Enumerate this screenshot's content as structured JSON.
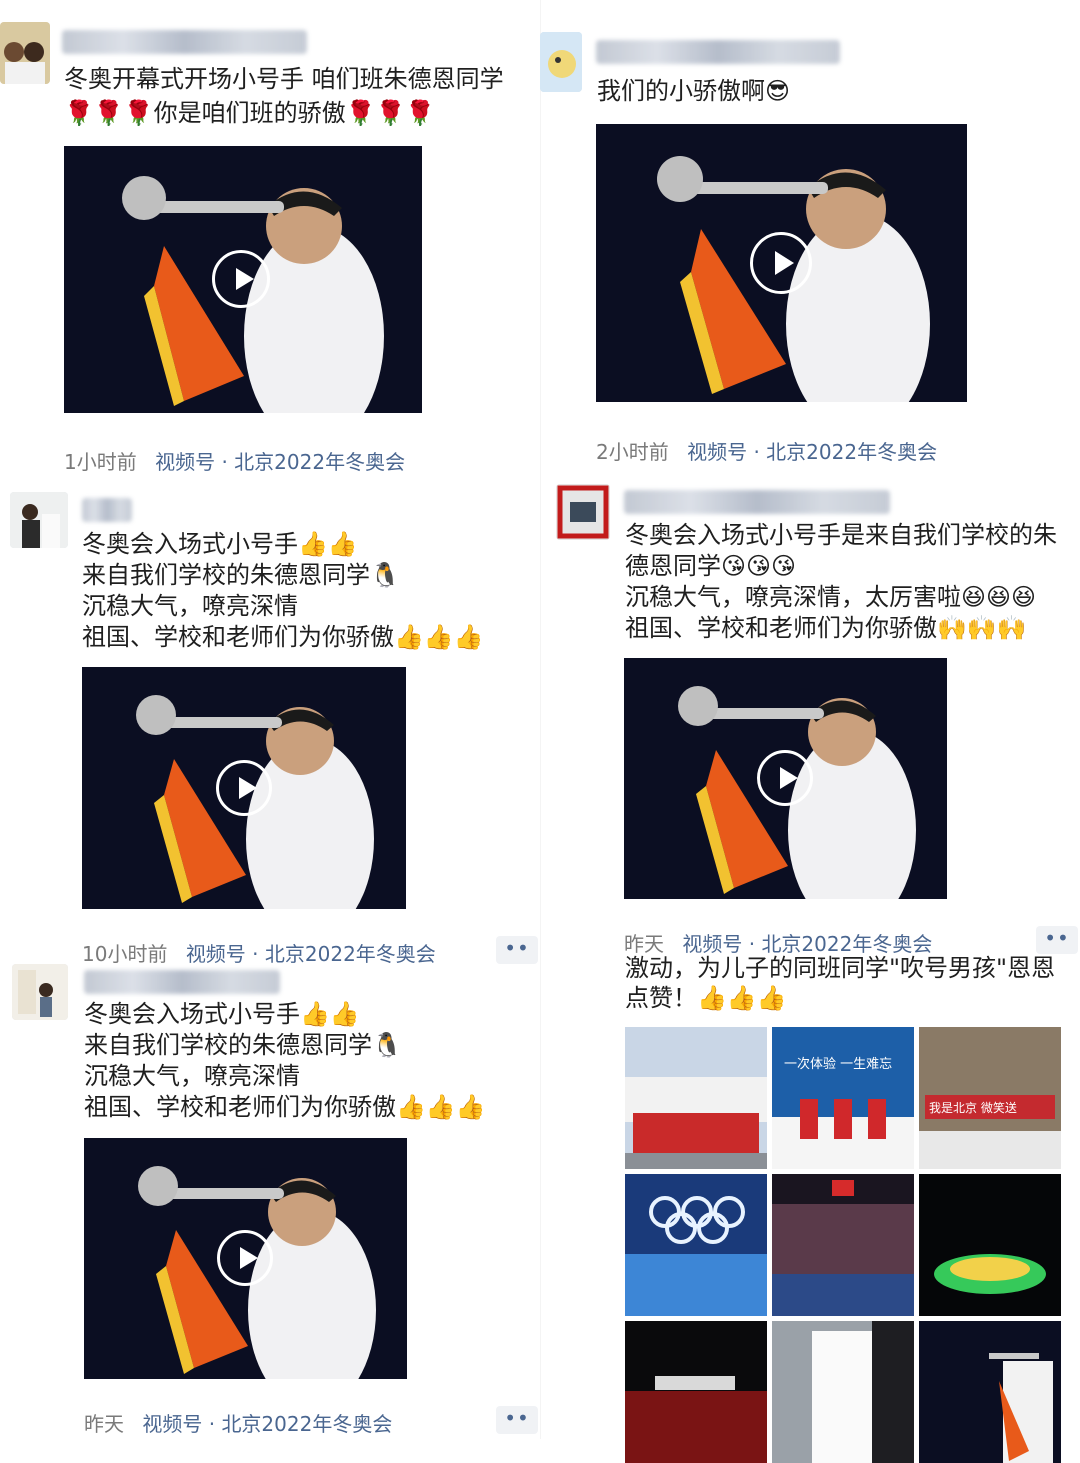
{
  "posts": [
    {
      "lines": [
        "冬奥开幕式开场小号手 咱们班朱德恩同学",
        "🌹🌹🌹你是咱们班的骄傲🌹🌹🌹"
      ],
      "time": "1小时前",
      "channel": "视频号",
      "topic": "北京2022年冬奥会"
    },
    {
      "lines": [
        "我们的小骄傲啊😎"
      ],
      "time": "2小时前",
      "channel": "视频号",
      "topic": "北京2022年冬奥会"
    },
    {
      "lines": [
        "冬奥会入场式小号手👍👍",
        "来自我们学校的朱德恩同学🐧",
        "沉稳大气，嘹亮深情",
        "祖国、学校和老师们为你骄傲👍👍👍"
      ],
      "time": "10小时前",
      "channel": "视频号",
      "topic": "北京2022年冬奥会",
      "more": "••"
    },
    {
      "lines": [
        "冬奥会入场式小号手是来自我们学校的朱",
        "德恩同学😘😘😘",
        "沉稳大气，嘹亮深情，太厉害啦😆😆😆",
        "祖国、学校和老师们为你骄傲🙌🙌🙌"
      ],
      "time": "昨天",
      "channel": "视频号",
      "topic": "北京2022年冬奥会",
      "more": "••"
    },
    {
      "lines": [
        "冬奥会入场式小号手👍👍",
        "来自我们学校的朱德恩同学🐧",
        "沉稳大气，嘹亮深情",
        "祖国、学校和老师们为你骄傲👍👍👍"
      ],
      "time": "昨天",
      "channel": "视频号",
      "topic": "北京2022年冬奥会",
      "more": "••"
    },
    {
      "lines": [
        "激动，为儿子的同班同学\"吹号男孩\"恩恩",
        "点赞！👍👍👍"
      ]
    }
  ],
  "photo_texts": {
    "banner_blue": "一次体验 一生难忘",
    "banner_red": "我是北京 微笑送"
  }
}
